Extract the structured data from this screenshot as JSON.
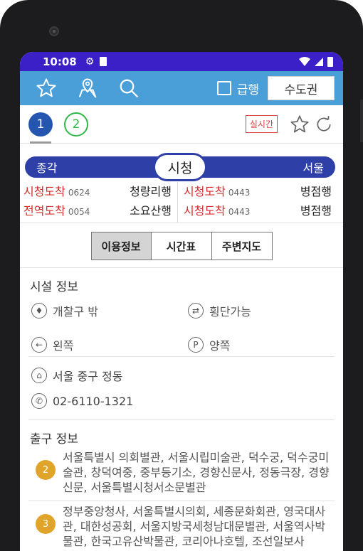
{
  "status_bar": {
    "time": "10:08"
  },
  "toolbar": {
    "express_label": "급행",
    "region_label": "수도권"
  },
  "lines": [
    {
      "label": "1"
    },
    {
      "label": "2"
    }
  ],
  "realtime_label": "실시간",
  "station": {
    "prev": "종각",
    "current": "시청",
    "next": "서울"
  },
  "arrivals": {
    "left": [
      {
        "status": "시청도착",
        "train": "0624",
        "dest": "청량리행"
      },
      {
        "status": "전역도착",
        "train": "0054",
        "dest": "소요산행"
      }
    ],
    "right": [
      {
        "status": "시청도착",
        "train": "0443",
        "dest": "병점행"
      },
      {
        "status": "시청도착",
        "train": "0443",
        "dest": "병점행"
      }
    ]
  },
  "tabs": [
    {
      "label": "이용정보"
    },
    {
      "label": "시간표"
    },
    {
      "label": "주변지도"
    }
  ],
  "facilities": {
    "title": "시설 정보",
    "items": [
      {
        "icon": "restroom-icon",
        "label": "개찰구 밖"
      },
      {
        "icon": "crossing-icon",
        "label": "횡단가능"
      },
      {
        "icon": "left-arrow-icon",
        "label": "왼쪽"
      },
      {
        "icon": "parking-icon",
        "label": "양쪽"
      }
    ]
  },
  "contact": {
    "address": "서울 중구 정동",
    "phone": "02-6110-1321"
  },
  "exits": {
    "title": "출구 정보",
    "items": [
      {
        "number": "2",
        "text": "서울특별시 의회별관, 서울시립미술관, 덕수궁, 덕수궁미술관, 창덕여중, 중부등기소, 경향신문사, 정동극장, 경향신문, 서울특별시청서소문별관"
      },
      {
        "number": "3",
        "text": "정부중앙청사, 서울특별시의회, 세종문화회관, 영국대사관, 대한성공회, 서울지방국세청남대문별관, 서울역사박물관, 한국고유산박물관, 코리아나호텔, 조선일보사"
      }
    ]
  },
  "colors": {
    "status_bar": "#3b1fc7",
    "toolbar": "#4a9fd8",
    "line1": "#2456b0",
    "line2": "#2fb847",
    "arrival_red": "#d42b2b",
    "exit_badge": "#e0a42a"
  }
}
